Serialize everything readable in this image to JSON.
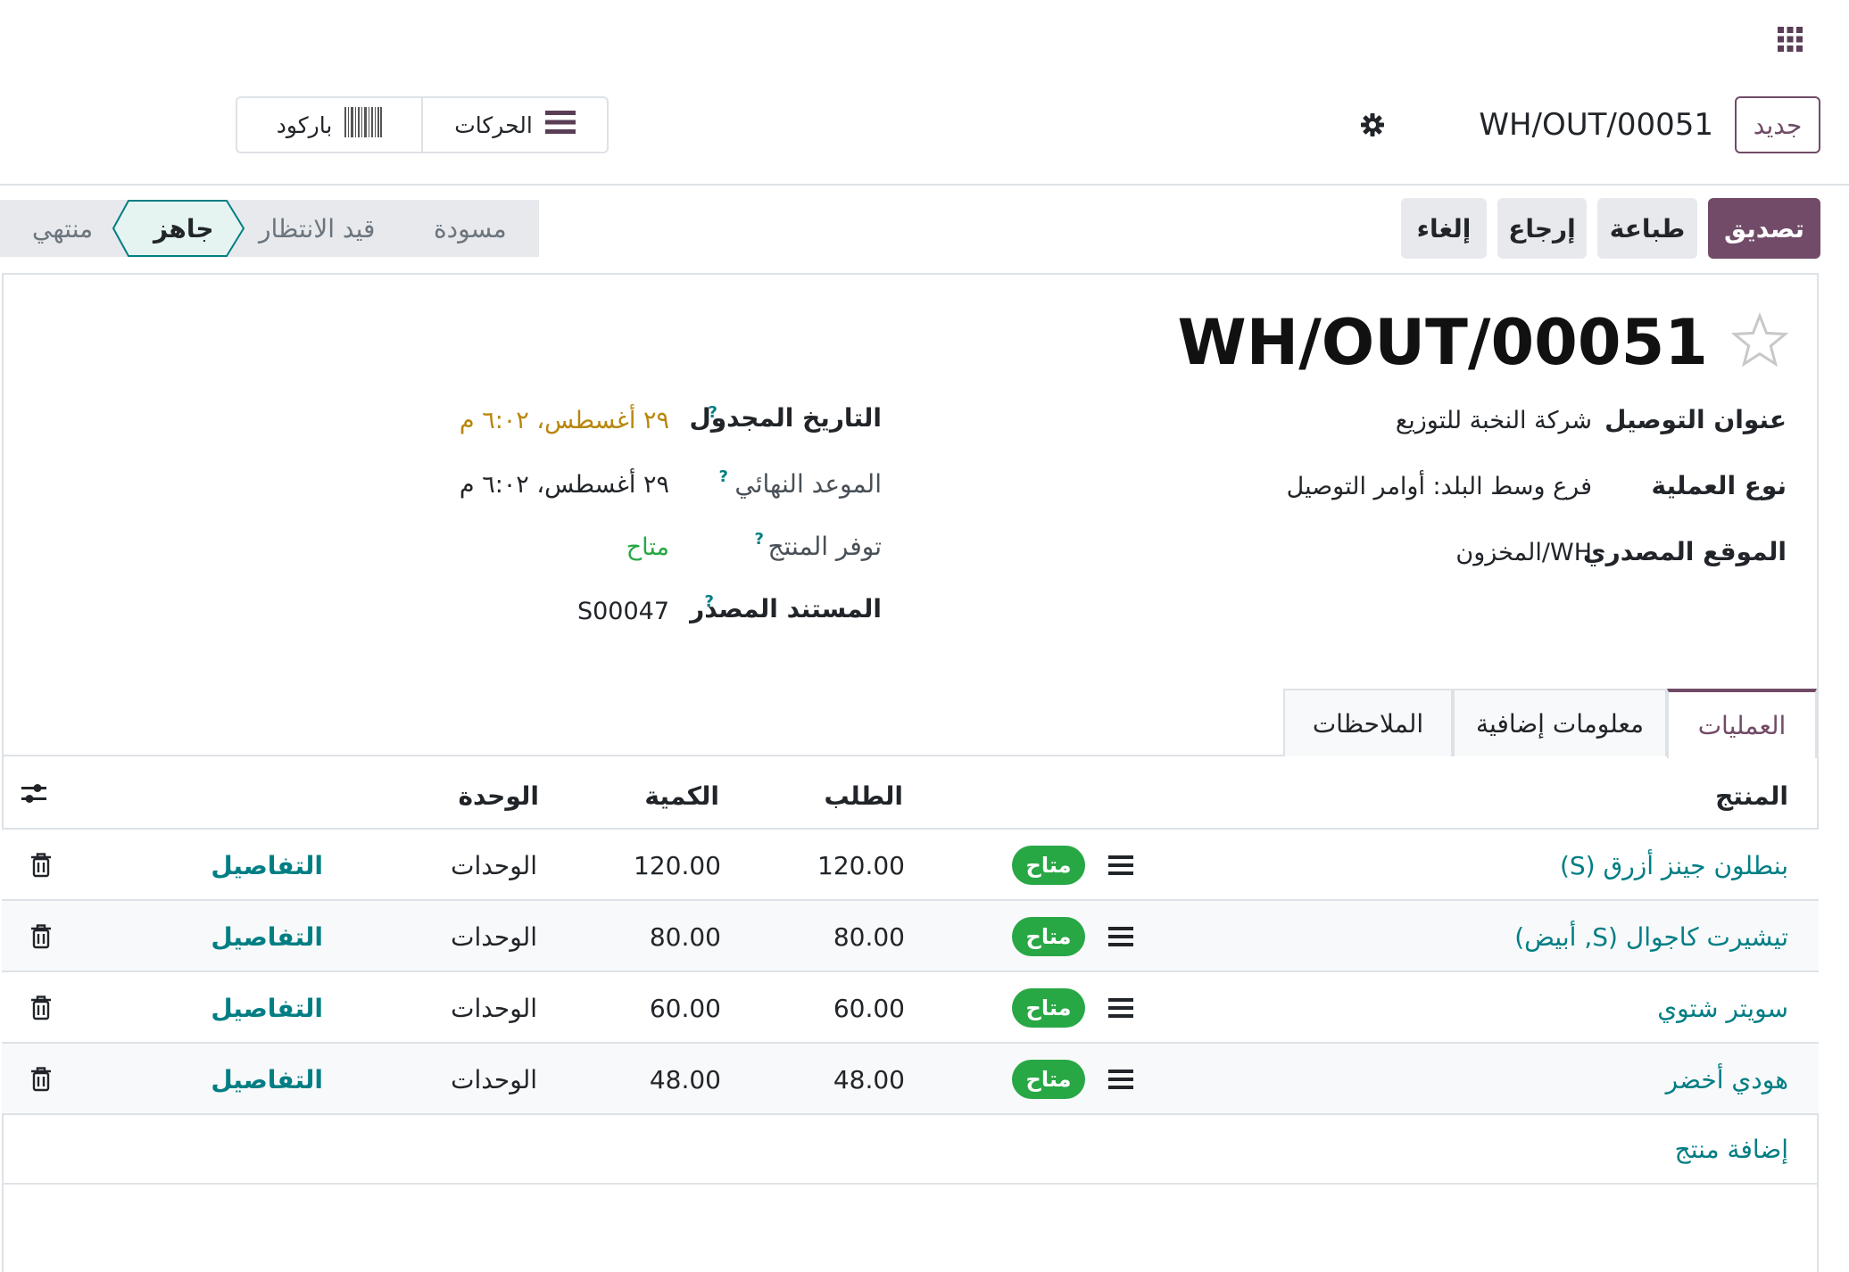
{
  "topbar": {
    "apps_icon": "grid-icon"
  },
  "control": {
    "new_label": "جديد",
    "record_ref": "WH/OUT/00051",
    "moves_label": "الحركات",
    "barcode_label": "باركود"
  },
  "actions": {
    "confirm": "تصديق",
    "print": "طباعة",
    "return": "إرجاع",
    "cancel": "إلغاء"
  },
  "statusbar": {
    "stages": [
      "مسودة",
      "قيد الانتظار",
      "جاهز",
      "منتهي"
    ],
    "active": "جاهز"
  },
  "form": {
    "title": "WH/OUT/00051",
    "left_fields": [
      {
        "label": "عنوان التوصيل",
        "value": "شركة النخبة للتوزيع"
      },
      {
        "label": "نوع العملية",
        "value": "فرع وسط البلد: أوامر التوصيل"
      },
      {
        "label": "الموقع المصدري",
        "value": "WH/المخزون"
      }
    ],
    "right_fields": [
      {
        "label": "التاريخ المجدول",
        "value": "٢٩ أغسطس، ٦:٠٢ م",
        "help": "?"
      },
      {
        "label": "الموعد النهائي",
        "value": "٢٩ أغسطس، ٦:٠٢ م",
        "help": "?"
      },
      {
        "label": "توفر المنتج",
        "value": "متاح",
        "help": "?"
      },
      {
        "label": "المستند المصدر",
        "value": "S00047",
        "help": "?"
      }
    ],
    "colors": {
      "scheduled": "#b8860b",
      "available": "#28a745",
      "accent": "#714B67",
      "link": "#017e84"
    }
  },
  "tabs": [
    "العمليات",
    "معلومات إضافية",
    "الملاحظات"
  ],
  "table": {
    "headers": {
      "product": "المنتج",
      "demand": "الطلب",
      "quantity": "الكمية",
      "unit": "الوحدة"
    },
    "rows": [
      {
        "product": "بنطلون جينز أزرق (S)",
        "status": "متاح",
        "demand": "120.00",
        "quantity": "120.00",
        "unit": "الوحدات",
        "details": "التفاصيل"
      },
      {
        "product": "تيشيرت كاجوال (S, أبيض)",
        "status": "متاح",
        "demand": "80.00",
        "quantity": "80.00",
        "unit": "الوحدات",
        "details": "التفاصيل"
      },
      {
        "product": "سويتر شتوي",
        "status": "متاح",
        "demand": "60.00",
        "quantity": "60.00",
        "unit": "الوحدات",
        "details": "التفاصيل"
      },
      {
        "product": "هودي أخضر",
        "status": "متاح",
        "demand": "48.00",
        "quantity": "48.00",
        "unit": "الوحدات",
        "details": "التفاصيل"
      }
    ],
    "add_line": "إضافة منتج"
  }
}
